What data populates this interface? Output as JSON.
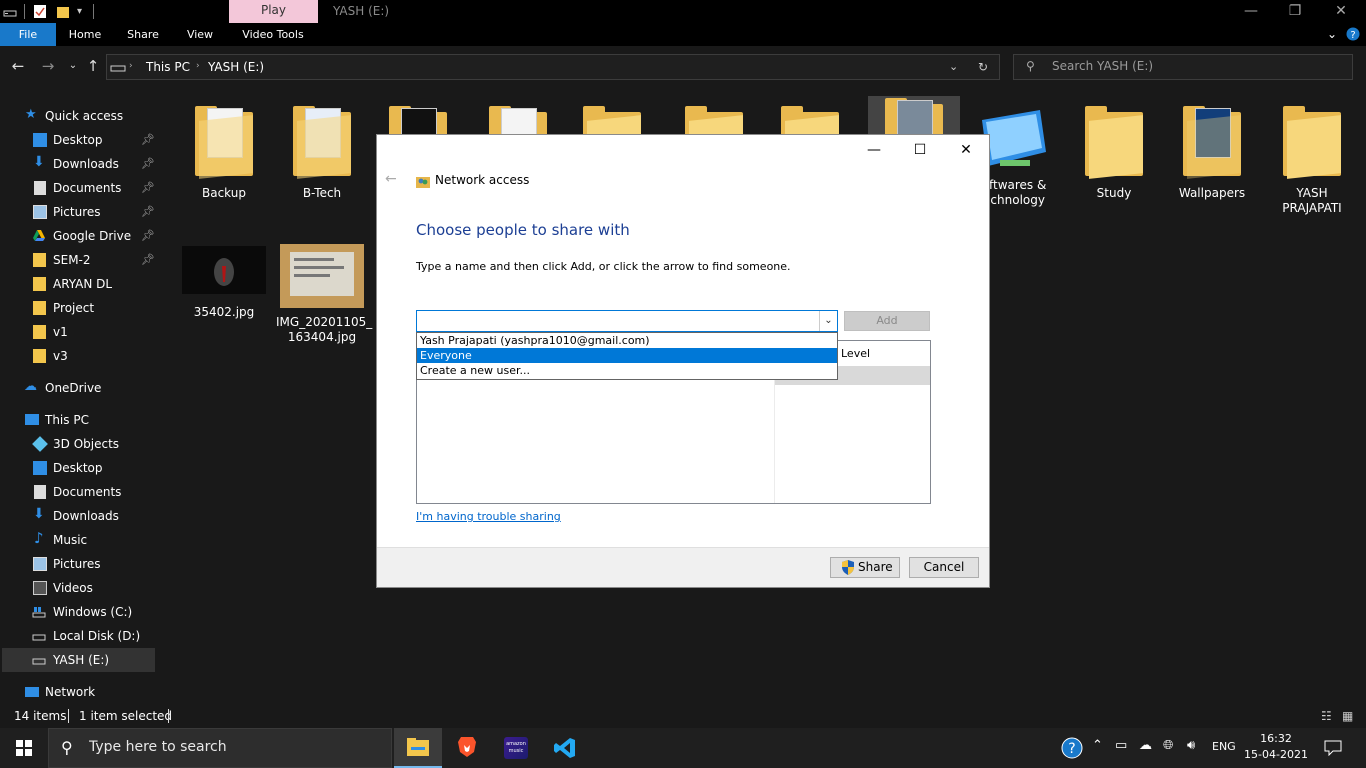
{
  "window": {
    "context_tab": "Play",
    "title": "YASH (E:)",
    "minimize": "—",
    "restore": "❐",
    "close": "✕"
  },
  "ribbon": {
    "tabs": [
      "File",
      "Home",
      "Share",
      "View",
      "Video Tools"
    ]
  },
  "address": {
    "crumbs": [
      "This PC",
      "YASH (E:)"
    ],
    "search_placeholder": "Search YASH (E:)"
  },
  "sidebar": {
    "quick_access": "Quick access",
    "pinned": [
      "Desktop",
      "Downloads",
      "Documents",
      "Pictures",
      "Google Drive",
      "SEM-2"
    ],
    "recent": [
      "ARYAN DL",
      "Project",
      "v1",
      "v3"
    ],
    "onedrive": "OneDrive",
    "this_pc": "This PC",
    "pc_items": [
      "3D Objects",
      "Desktop",
      "Documents",
      "Downloads",
      "Music",
      "Pictures",
      "Videos",
      "Windows (C:)",
      "Local Disk (D:)",
      "YASH (E:)"
    ],
    "network": "Network"
  },
  "files": {
    "row1": [
      "Backup",
      "B-Tech",
      "",
      "",
      "",
      "",
      "",
      "",
      "oftwares &",
      "Study",
      "Wallpapers",
      "YASH"
    ],
    "row1_line2": [
      "",
      "",
      "",
      "",
      "",
      "",
      "",
      "",
      "echnology",
      "",
      "",
      "PRAJAPATI"
    ],
    "row2": [
      "35402.jpg",
      "IMG_20201105_"
    ],
    "row2_line2": [
      "",
      "163404.jpg"
    ]
  },
  "status": {
    "items": "14 items",
    "selected": "1 item selected"
  },
  "taskbar": {
    "search_placeholder": "Type here to search",
    "music_label": "amazon music",
    "lang": "ENG",
    "time": "16:32",
    "date": "15-04-2021"
  },
  "dialog": {
    "title": "Network access",
    "heading": "Choose people to share with",
    "instruction": "Type a name and then click Add, or click the arrow to find someone.",
    "input_value": "",
    "add_label": "Add",
    "column_level": "Level",
    "dropdown_options": [
      "Yash Prajapati (yashpra1010@gmail.com)",
      "Everyone",
      "Create a new user..."
    ],
    "dropdown_highlighted": "Everyone",
    "trouble_link": "I'm having trouble sharing",
    "share_label": "Share",
    "cancel_label": "Cancel",
    "minimize": "—",
    "maximize": "☐",
    "close": "✕"
  },
  "colors": {
    "accent": "#0078d7",
    "file_tab": "#1979ca",
    "context_tab": "#f3c7d9",
    "heading": "#1c3f94",
    "folder": "#e9b94f"
  }
}
